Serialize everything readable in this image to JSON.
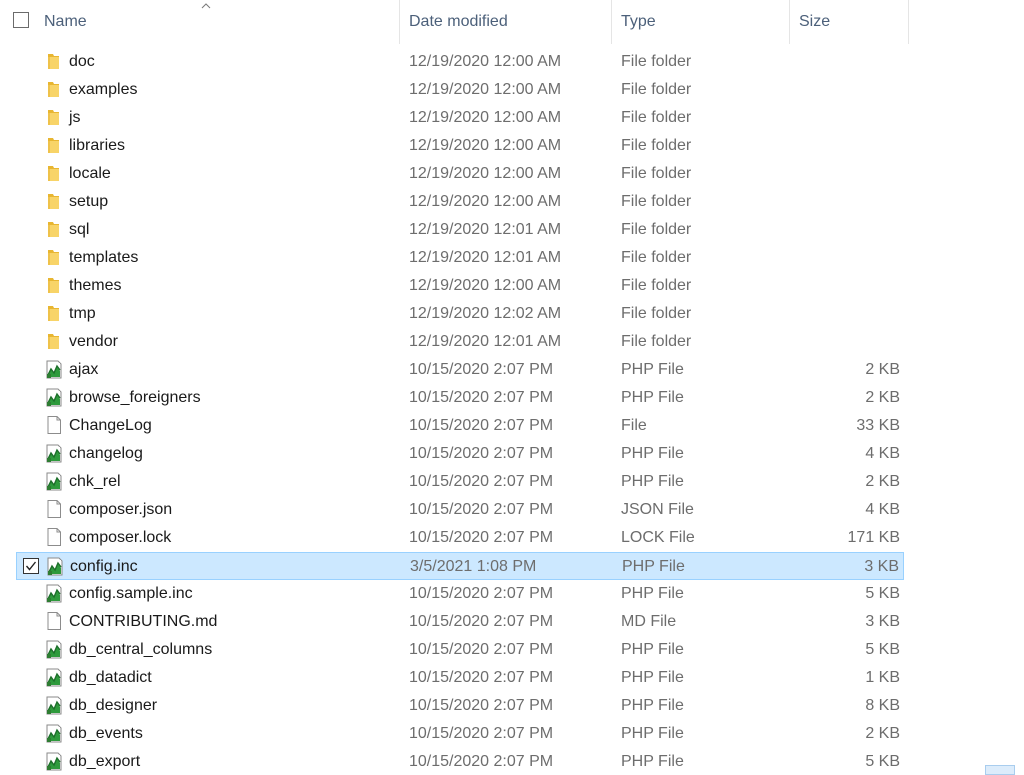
{
  "header": {
    "name": "Name",
    "date_modified": "Date modified",
    "type": "Type",
    "size": "Size"
  },
  "files": [
    {
      "name": "doc",
      "date": "12/19/2020 12:00 AM",
      "type": "File folder",
      "size": "",
      "icon": "folder-icon",
      "selected": false
    },
    {
      "name": "examples",
      "date": "12/19/2020 12:00 AM",
      "type": "File folder",
      "size": "",
      "icon": "folder-icon",
      "selected": false
    },
    {
      "name": "js",
      "date": "12/19/2020 12:00 AM",
      "type": "File folder",
      "size": "",
      "icon": "folder-icon",
      "selected": false
    },
    {
      "name": "libraries",
      "date": "12/19/2020 12:00 AM",
      "type": "File folder",
      "size": "",
      "icon": "folder-icon",
      "selected": false
    },
    {
      "name": "locale",
      "date": "12/19/2020 12:00 AM",
      "type": "File folder",
      "size": "",
      "icon": "folder-icon",
      "selected": false
    },
    {
      "name": "setup",
      "date": "12/19/2020 12:00 AM",
      "type": "File folder",
      "size": "",
      "icon": "folder-icon",
      "selected": false
    },
    {
      "name": "sql",
      "date": "12/19/2020 12:01 AM",
      "type": "File folder",
      "size": "",
      "icon": "folder-icon",
      "selected": false
    },
    {
      "name": "templates",
      "date": "12/19/2020 12:01 AM",
      "type": "File folder",
      "size": "",
      "icon": "folder-icon",
      "selected": false
    },
    {
      "name": "themes",
      "date": "12/19/2020 12:00 AM",
      "type": "File folder",
      "size": "",
      "icon": "folder-icon",
      "selected": false
    },
    {
      "name": "tmp",
      "date": "12/19/2020 12:02 AM",
      "type": "File folder",
      "size": "",
      "icon": "folder-icon",
      "selected": false
    },
    {
      "name": "vendor",
      "date": "12/19/2020 12:01 AM",
      "type": "File folder",
      "size": "",
      "icon": "folder-icon",
      "selected": false
    },
    {
      "name": "ajax",
      "date": "10/15/2020 2:07 PM",
      "type": "PHP File",
      "size": "2 KB",
      "icon": "php-file-icon",
      "selected": false
    },
    {
      "name": "browse_foreigners",
      "date": "10/15/2020 2:07 PM",
      "type": "PHP File",
      "size": "2 KB",
      "icon": "php-file-icon",
      "selected": false
    },
    {
      "name": "ChangeLog",
      "date": "10/15/2020 2:07 PM",
      "type": "File",
      "size": "33 KB",
      "icon": "blank-file-icon",
      "selected": false
    },
    {
      "name": "changelog",
      "date": "10/15/2020 2:07 PM",
      "type": "PHP File",
      "size": "4 KB",
      "icon": "php-file-icon",
      "selected": false
    },
    {
      "name": "chk_rel",
      "date": "10/15/2020 2:07 PM",
      "type": "PHP File",
      "size": "2 KB",
      "icon": "php-file-icon",
      "selected": false
    },
    {
      "name": "composer.json",
      "date": "10/15/2020 2:07 PM",
      "type": "JSON File",
      "size": "4 KB",
      "icon": "blank-file-icon",
      "selected": false
    },
    {
      "name": "composer.lock",
      "date": "10/15/2020 2:07 PM",
      "type": "LOCK File",
      "size": "171 KB",
      "icon": "blank-file-icon",
      "selected": false
    },
    {
      "name": "config.inc",
      "date": "3/5/2021 1:08 PM",
      "type": "PHP File",
      "size": "3 KB",
      "icon": "php-file-icon",
      "selected": true
    },
    {
      "name": "config.sample.inc",
      "date": "10/15/2020 2:07 PM",
      "type": "PHP File",
      "size": "5 KB",
      "icon": "php-file-icon",
      "selected": false
    },
    {
      "name": "CONTRIBUTING.md",
      "date": "10/15/2020 2:07 PM",
      "type": "MD File",
      "size": "3 KB",
      "icon": "blank-file-icon",
      "selected": false
    },
    {
      "name": "db_central_columns",
      "date": "10/15/2020 2:07 PM",
      "type": "PHP File",
      "size": "5 KB",
      "icon": "php-file-icon",
      "selected": false
    },
    {
      "name": "db_datadict",
      "date": "10/15/2020 2:07 PM",
      "type": "PHP File",
      "size": "1 KB",
      "icon": "php-file-icon",
      "selected": false
    },
    {
      "name": "db_designer",
      "date": "10/15/2020 2:07 PM",
      "type": "PHP File",
      "size": "8 KB",
      "icon": "php-file-icon",
      "selected": false
    },
    {
      "name": "db_events",
      "date": "10/15/2020 2:07 PM",
      "type": "PHP File",
      "size": "2 KB",
      "icon": "php-file-icon",
      "selected": false
    },
    {
      "name": "db_export",
      "date": "10/15/2020 2:07 PM",
      "type": "PHP File",
      "size": "5 KB",
      "icon": "php-file-icon",
      "selected": false
    }
  ]
}
